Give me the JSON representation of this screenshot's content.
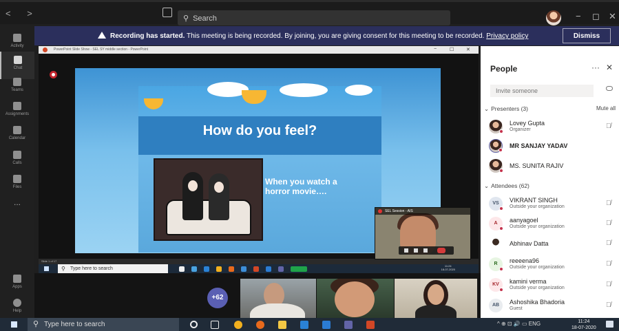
{
  "titlebar": {
    "nav_label": "< >",
    "search_placeholder": "Search",
    "win_minimize": "−",
    "win_maximize": "◻",
    "win_close": "✕"
  },
  "rail": {
    "items": [
      {
        "label": "Activity",
        "icon": "bell-icon"
      },
      {
        "label": "Chat",
        "icon": "chat-icon"
      },
      {
        "label": "Teams",
        "icon": "teams-icon"
      },
      {
        "label": "Assignments",
        "icon": "assignments-icon"
      },
      {
        "label": "Calendar",
        "icon": "calendar-icon"
      },
      {
        "label": "Calls",
        "icon": "phone-icon"
      },
      {
        "label": "Files",
        "icon": "files-icon"
      },
      {
        "label": "...",
        "icon": "more-icon"
      },
      {
        "label": "Apps",
        "icon": "apps-icon"
      },
      {
        "label": "Help",
        "icon": "help-icon"
      }
    ]
  },
  "banner": {
    "bold": "Recording has started.",
    "text": " This meeting is being recorded. By joining, you are giving consent for this meeting to be recorded. ",
    "link": "Privacy policy",
    "dismiss": "Dismiss"
  },
  "share": {
    "ppt_title": "PowerPoint Slide Show  -  SEL SY middle section - PowerPoint",
    "ppt_min": "−",
    "ppt_max": "☐",
    "ppt_close": "✕",
    "slide_title": "How do you feel?",
    "slide_sub": "When you watch a horror movie….",
    "status": "Slide 1 of 17",
    "inner_search": "Type here to search",
    "inner_time": "11:24",
    "inner_date": "18-07-2020"
  },
  "selfview": {
    "title": "SEL Session - AIS"
  },
  "strip": {
    "overflow": "+62"
  },
  "panel": {
    "title": "People",
    "more": "···",
    "close": "✕",
    "invite_placeholder": "Invite someone",
    "presenters_label": "Presenters (3)",
    "mute_all": "Mute all",
    "attendees_label": "Attendees (62)",
    "presenters": [
      {
        "name": "Lovey Gupta",
        "role": "Organizer"
      },
      {
        "name": "MR SANJAY YADAV",
        "role": ""
      },
      {
        "name": "MS. SUNITA RAJIV",
        "role": ""
      }
    ],
    "attendees": [
      {
        "initials": "VS",
        "name": "VIKRANT SINGH",
        "role": "Outside your organization",
        "color": "#e0e6ef",
        "fg": "#44546a"
      },
      {
        "initials": "A",
        "name": "aanyagoel",
        "role": "Outside your organization",
        "color": "#fde7e9",
        "fg": "#a4262c"
      },
      {
        "initials": "",
        "name": "Abhinav Datta",
        "role": "",
        "color": "",
        "fg": ""
      },
      {
        "initials": "R",
        "name": "reeeena96",
        "role": "Outside your organization",
        "color": "#e7f5e2",
        "fg": "#2b6c1f"
      },
      {
        "initials": "KV",
        "name": "kamini verma",
        "role": "Outside your organization",
        "color": "#fde7e9",
        "fg": "#a4262c"
      },
      {
        "initials": "AB",
        "name": "Ashoshika Bhadoria",
        "role": "Guest",
        "color": "#e9ecef",
        "fg": "#44546a"
      }
    ]
  },
  "taskbar": {
    "search_placeholder": "Type here to search",
    "tray": "^ ⊕ ⊡ 🔊 ▭ ENG",
    "time": "11:24",
    "date": "18-07-2020"
  }
}
